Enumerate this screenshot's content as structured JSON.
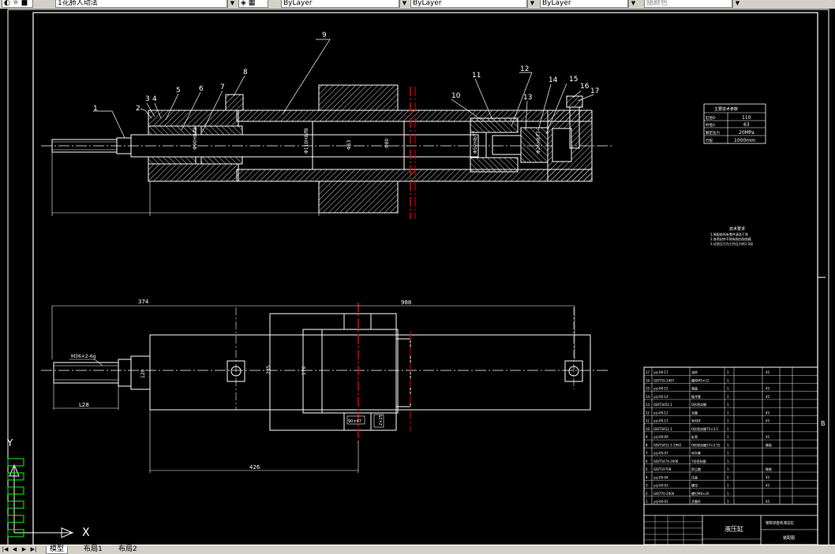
{
  "toolbar": {
    "layer_name": "1花肺人动法",
    "color_select": "ByLayer",
    "linetype_select": "ByLayer",
    "lineweight_select": "ByLayer",
    "plotstyle_select": "随颜色"
  },
  "tabs": [
    {
      "label": "模型"
    },
    {
      "label": "布局1"
    },
    {
      "label": "布局2"
    }
  ],
  "drawing": {
    "balloons": [
      "1",
      "2",
      "3",
      "4",
      "5",
      "6",
      "7",
      "8",
      "9",
      "10",
      "11",
      "12",
      "13",
      "14",
      "15",
      "16",
      "17"
    ],
    "dim_top_374": "374",
    "dim_top_988": "988",
    "dim_426": "426",
    "dim_120": "120",
    "dim_170": "170",
    "dim_235": "235",
    "dim_thread": "M36×2-6g",
    "dim_thread_len": "L28",
    "dim_block": "90×47",
    "dim_block2": "2×25",
    "zone_b": "B"
  },
  "params_table": {
    "title": "主要技术参数",
    "rows": [
      {
        "label": "缸径D",
        "value": "110"
      },
      {
        "label": "杆径d",
        "value": "63"
      },
      {
        "label": "额定压力",
        "value": "20MPa"
      },
      {
        "label": "行程",
        "value": "1000mm"
      }
    ]
  },
  "tech_notes": {
    "title": "技术要求",
    "lines": [
      "1.装配前所有零件清洗干净",
      "2.各密封件不得有损伤和划痕",
      "3.试验压力为工作压力的1.5倍"
    ]
  },
  "bom": [
    {
      "no": "17",
      "code": "yzj-00-17",
      "name": "油杯",
      "qty": "1",
      "mat": "45"
    },
    {
      "no": "16",
      "code": "GB/T55-1987",
      "name": "螺栓M5×12",
      "qty": "1",
      "mat": ""
    },
    {
      "no": "15",
      "code": "yzj-00-15",
      "name": "端盖",
      "qty": "1",
      "mat": "45"
    },
    {
      "no": "14",
      "code": "yzj-00-14",
      "name": "缓冲套",
      "qty": "1",
      "mat": "45"
    },
    {
      "no": "13",
      "code": "GB/T3452.1",
      "name": "O形密封圈",
      "qty": "1",
      "mat": ""
    },
    {
      "no": "12",
      "code": "yzj-00-12",
      "name": "活塞",
      "qty": "1",
      "mat": "45"
    },
    {
      "no": "11",
      "code": "yzj-00-11",
      "name": "导向环",
      "qty": "1",
      "mat": "45"
    },
    {
      "no": "10",
      "code": "GB/T3452.1",
      "name": "O形密封圈75×3.5",
      "qty": "1",
      "mat": ""
    },
    {
      "no": "9",
      "code": "yzj-00-09",
      "name": "缸筒",
      "qty": "1",
      "mat": "45"
    },
    {
      "no": "8",
      "code": "GB/T3452.1-1992",
      "name": "O形密封圈37×3.55",
      "qty": "1",
      "mat": "橡胶"
    },
    {
      "no": "7",
      "code": "yzj-00-07",
      "name": "导向套",
      "qty": "1",
      "mat": ""
    },
    {
      "no": "6",
      "code": "GB/T5474-2006",
      "name": "Y形密封圈",
      "qty": "1",
      "mat": ""
    },
    {
      "no": "5",
      "code": "GB/T10708",
      "name": "防尘圈",
      "qty": "1",
      "mat": "橡胶"
    },
    {
      "no": "4",
      "code": "yzj-00-04",
      "name": "压盖",
      "qty": "2",
      "mat": "45"
    },
    {
      "no": "3",
      "code": "yzj-00-03",
      "name": "螺母",
      "qty": "1",
      "mat": "45"
    },
    {
      "no": "2",
      "code": "GB/T70-2000",
      "name": "螺钉M6×20",
      "qty": "1",
      "mat": ""
    },
    {
      "no": "1",
      "code": "yzj-00-01",
      "name": "活塞杆",
      "qty": "1",
      "mat": "45"
    }
  ],
  "title_block": {
    "drawing_name": "液压缸",
    "project": "钢管调直机液压缸",
    "sheet": "装配图"
  },
  "ucs": {
    "x_label": "X",
    "y_label": "Y"
  }
}
